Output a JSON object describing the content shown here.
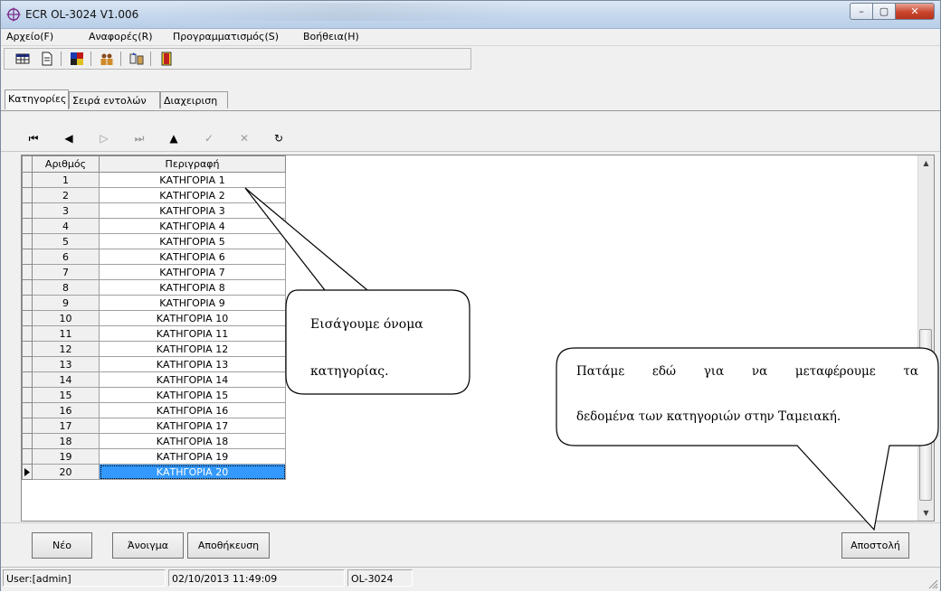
{
  "window": {
    "title": "ECR OL-3024 V1.006",
    "minimize_icon": "minimize-icon",
    "maximize_icon": "maximize-icon",
    "close_icon": "close-icon",
    "minimize_glyph": "–",
    "maximize_glyph": "▢",
    "close_glyph": "✕"
  },
  "menu": [
    "Αρχείο(F)",
    "Αναφορές(R)",
    "Προγραμματισμός(S)",
    "Βοήθεια(H)"
  ],
  "toolbar_icons": [
    "grid-icon",
    "document-icon",
    "palette-icon",
    "users-icon",
    "transfer-icon",
    "exit-door-icon"
  ],
  "tabs": [
    "Κατηγορίες",
    "Σειρά εντολών",
    "Διαχειριση"
  ],
  "navigator": {
    "icons": [
      "first-record-icon",
      "prior-record-icon",
      "next-record-icon",
      "last-record-icon",
      "insert-record-icon",
      "post-edit-icon",
      "cancel-edit-icon",
      "refresh-icon"
    ],
    "glyphs": [
      "⏮",
      "◀",
      "▷",
      "⏭",
      "▲",
      "✓",
      "✕",
      "↻"
    ]
  },
  "grid": {
    "columns": [
      "Αριθμός",
      "Περιγραφή"
    ],
    "rows": [
      {
        "num": "1",
        "desc": "ΚΑΤΗΓΟΡΙΑ 1"
      },
      {
        "num": "2",
        "desc": "ΚΑΤΗΓΟΡΙΑ 2"
      },
      {
        "num": "3",
        "desc": "ΚΑΤΗΓΟΡΙΑ 3"
      },
      {
        "num": "4",
        "desc": "ΚΑΤΗΓΟΡΙΑ 4"
      },
      {
        "num": "5",
        "desc": "ΚΑΤΗΓΟΡΙΑ 5"
      },
      {
        "num": "6",
        "desc": "ΚΑΤΗΓΟΡΙΑ 6"
      },
      {
        "num": "7",
        "desc": "ΚΑΤΗΓΟΡΙΑ 7"
      },
      {
        "num": "8",
        "desc": "ΚΑΤΗΓΟΡΙΑ 8"
      },
      {
        "num": "9",
        "desc": "ΚΑΤΗΓΟΡΙΑ 9"
      },
      {
        "num": "10",
        "desc": "ΚΑΤΗΓΟΡΙΑ 10"
      },
      {
        "num": "11",
        "desc": "ΚΑΤΗΓΟΡΙΑ 11"
      },
      {
        "num": "12",
        "desc": "ΚΑΤΗΓΟΡΙΑ 12"
      },
      {
        "num": "13",
        "desc": "ΚΑΤΗΓΟΡΙΑ 13"
      },
      {
        "num": "14",
        "desc": "ΚΑΤΗΓΟΡΙΑ 14"
      },
      {
        "num": "15",
        "desc": "ΚΑΤΗΓΟΡΙΑ 15"
      },
      {
        "num": "16",
        "desc": "ΚΑΤΗΓΟΡΙΑ 16"
      },
      {
        "num": "17",
        "desc": "ΚΑΤΗΓΟΡΙΑ 17"
      },
      {
        "num": "18",
        "desc": "ΚΑΤΗΓΟΡΙΑ 18"
      },
      {
        "num": "19",
        "desc": "ΚΑΤΗΓΟΡΙΑ 19"
      },
      {
        "num": "20",
        "desc": "ΚΑΤΗΓΟΡΙΑ 20"
      }
    ],
    "selected_row": "20",
    "selection_color": "#3399ff"
  },
  "buttons": {
    "new": "Νέο",
    "open": "Άνοιγμα",
    "save": "Αποθήκευση",
    "send": "Αποστολή"
  },
  "status": {
    "user": "User:[admin]",
    "datetime": "02/10/2013 11:49:09",
    "model": "OL-3024"
  },
  "callouts": {
    "category": [
      "Εισάγουμε όνομα",
      "κατηγορίας."
    ],
    "send": [
      "Πατάμε εδώ για να μεταφέρουμε τα",
      "δεδομένα των κατηγοριών στην Ταμειακή."
    ]
  }
}
